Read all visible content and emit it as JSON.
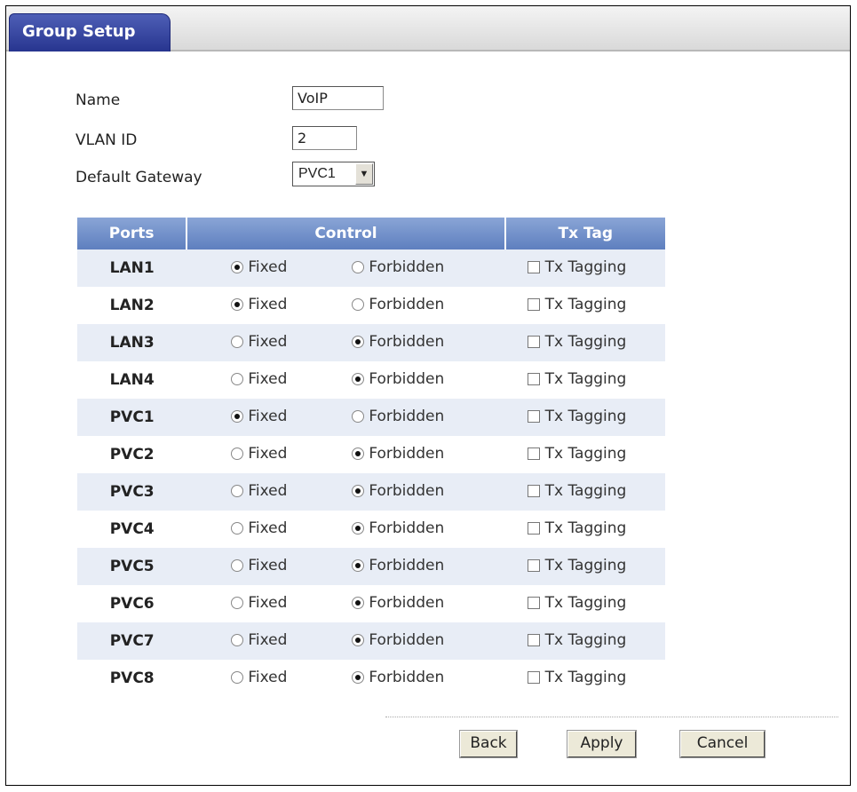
{
  "tab": {
    "title": "Group Setup"
  },
  "form": {
    "name_label": "Name",
    "name_value": "VoIP",
    "vlan_label": "VLAN ID",
    "vlan_value": "2",
    "gateway_label": "Default Gateway",
    "gateway_value": "PVC1"
  },
  "table": {
    "headers": {
      "ports": "Ports",
      "control": "Control",
      "tx_tag": "Tx Tag"
    },
    "option_fixed": "Fixed",
    "option_forbidden": "Forbidden",
    "option_tagging": "Tx Tagging",
    "rows": [
      {
        "port": "LAN1",
        "control": "Fixed",
        "tx_tagging": false
      },
      {
        "port": "LAN2",
        "control": "Fixed",
        "tx_tagging": false
      },
      {
        "port": "LAN3",
        "control": "Forbidden",
        "tx_tagging": false
      },
      {
        "port": "LAN4",
        "control": "Forbidden",
        "tx_tagging": false
      },
      {
        "port": "PVC1",
        "control": "Fixed",
        "tx_tagging": false
      },
      {
        "port": "PVC2",
        "control": "Forbidden",
        "tx_tagging": false
      },
      {
        "port": "PVC3",
        "control": "Forbidden",
        "tx_tagging": false
      },
      {
        "port": "PVC4",
        "control": "Forbidden",
        "tx_tagging": false
      },
      {
        "port": "PVC5",
        "control": "Forbidden",
        "tx_tagging": false
      },
      {
        "port": "PVC6",
        "control": "Forbidden",
        "tx_tagging": false
      },
      {
        "port": "PVC7",
        "control": "Forbidden",
        "tx_tagging": false
      },
      {
        "port": "PVC8",
        "control": "Forbidden",
        "tx_tagging": false
      }
    ]
  },
  "buttons": {
    "back": "Back",
    "apply": "Apply",
    "cancel": "Cancel"
  },
  "icons": {
    "dropdown": "chevron-down-icon"
  }
}
